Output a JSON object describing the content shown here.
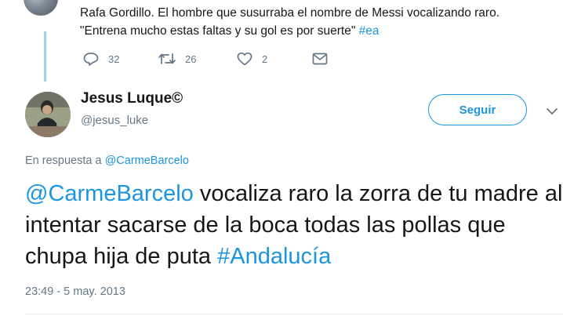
{
  "parent_tweet": {
    "text_line1": "Rafa Gordillo. El hombre que susurraba el nombre de Messi vocalizando raro.",
    "text_line2_plain": "\"Entrena mucho estas faltas y su gol es por suerte\"",
    "text_line2_hashtag": "#ea",
    "actions": {
      "reply_count": "32",
      "retweet_count": "26",
      "like_count": "2"
    }
  },
  "reply_tweet": {
    "author": {
      "display_name": "Jesus Luque©",
      "handle": "@jesus_luke"
    },
    "follow_label": "Seguir",
    "reply_context_prefix": "En respuesta a",
    "reply_context_mention": "@CarmeBarcelo",
    "body": {
      "mention": "@CarmeBarcelo",
      "text": "vocaliza raro la zorra de tu madre al intentar sacarse de la boca todas las pollas que chupa hija de puta",
      "hashtag": "#Andalucía"
    },
    "timestamp": "23:49 - 5 may. 2013"
  },
  "colors": {
    "link": "#1b95e0",
    "muted": "#657786",
    "text": "#14171a",
    "thread_line": "#9fd2f2"
  },
  "icons": [
    "reply-icon",
    "retweet-icon",
    "like-icon",
    "message-icon",
    "chevron-down-icon"
  ]
}
